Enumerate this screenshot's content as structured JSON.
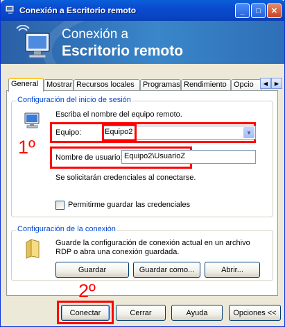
{
  "window": {
    "title": "Conexión a Escritorio remoto",
    "controls": {
      "minimize": "_",
      "maximize": "□",
      "close": "✕"
    }
  },
  "banner": {
    "line1": "Conexión a",
    "line2": "Escritorio remoto"
  },
  "tabs": [
    {
      "label": "General",
      "active": true
    },
    {
      "label": "Mostrar"
    },
    {
      "label": "Recursos locales"
    },
    {
      "label": "Programas"
    },
    {
      "label": "Rendimiento"
    },
    {
      "label": "Opcio"
    }
  ],
  "tab_scroll": {
    "left": "◀",
    "right": "▶"
  },
  "login_group": {
    "title": "Configuración del inicio de sesión",
    "instruction": "Escriba el nombre del equipo remoto.",
    "computer_label": "Equipo:",
    "computer_value": "Equipo2",
    "combo_arrow": "▼",
    "username_label": "Nombre de usuario:",
    "username_value": "Equipo2\\UsuarioZ",
    "credentials_note": "Se solicitarán credenciales al conectarse.",
    "save_credentials_label": "Permitirme guardar las credenciales",
    "save_credentials_checked": false
  },
  "connection_group": {
    "title": "Configuración de la conexión",
    "description_line1": "Guarde la configuración de conexión actual en un archivo",
    "description_line2": "RDP o abra una conexión guardada.",
    "save_button": "Guardar",
    "save_as_button": "Guardar como...",
    "open_button": "Abrir..."
  },
  "footer": {
    "connect_button": "Conectar",
    "close_button": "Cerrar",
    "help_button": "Ayuda",
    "options_button": "Opciones <<"
  },
  "annotations": {
    "label1": "1º",
    "label2": "2º",
    "color": "#ff0000"
  }
}
